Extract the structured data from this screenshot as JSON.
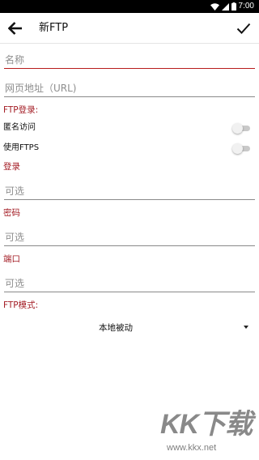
{
  "status_bar": {
    "time": "7:00"
  },
  "toolbar": {
    "title": "新FTP"
  },
  "form": {
    "name_placeholder": "名称",
    "url_placeholder": "网页地址（URL)",
    "ftp_login_label": "FTP登录:",
    "anonymous_label": "匿名访问",
    "anonymous_on": false,
    "ftps_label": "使用FTPS",
    "ftps_on": false,
    "login_label": "登录",
    "login_placeholder": "可选",
    "password_label": "密码",
    "password_placeholder": "可选",
    "port_label": "端口",
    "port_placeholder": "可选",
    "ftp_mode_label": "FTP模式:",
    "ftp_mode_value": "本地被动"
  },
  "watermark": {
    "brand": "KK下载",
    "url": "www.kkx.net"
  },
  "colors": {
    "accent": "#a31c24",
    "focus_underline": "#b71c1c",
    "switch_off": "#c9c9c9"
  },
  "icons": {
    "back": "arrow-left-icon",
    "confirm": "check-icon",
    "wifi": "wifi-icon",
    "signal": "signal-icon",
    "battery": "battery-icon",
    "dropdown": "dropdown-arrow-icon"
  }
}
